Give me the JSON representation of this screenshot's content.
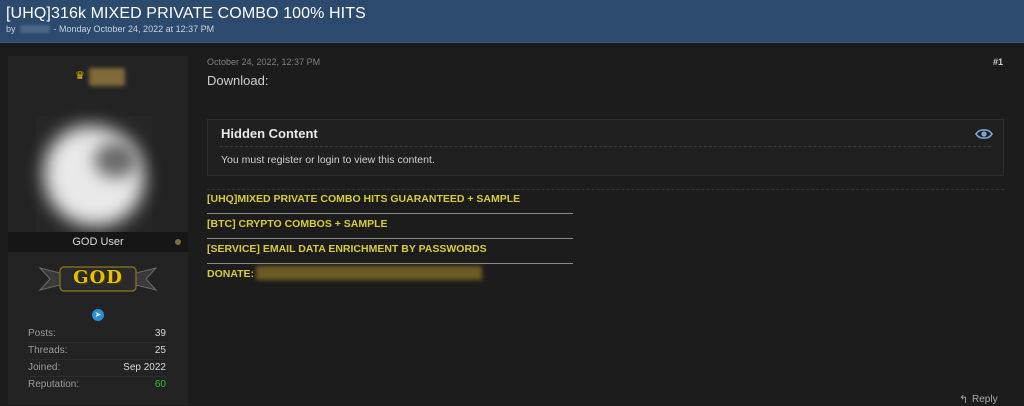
{
  "thread": {
    "title": "[UHQ]316k MIXED PRIVATE COMBO 100% HITS",
    "by_label": "by",
    "date_meta": "- Monday October 24, 2022 at 12:37 PM"
  },
  "user": {
    "rank_title": "GOD User",
    "badge_text": "GOD",
    "stats": [
      {
        "label": "Posts:",
        "value": "39"
      },
      {
        "label": "Threads:",
        "value": "25"
      },
      {
        "label": "Joined:",
        "value": "Sep 2022"
      },
      {
        "label": "Reputation:",
        "value": "60"
      }
    ]
  },
  "post": {
    "date": "October 24, 2022, 12:37 PM",
    "number": "#1",
    "download_label": "Download:",
    "hidden_title": "Hidden Content",
    "hidden_message": "You must register or login to view this content.",
    "links": [
      "[UHQ]MIXED PRIVATE COMBO HITS GUARANTEED + SAMPLE",
      "[BTC] CRYPTO COMBOS + SAMPLE",
      "[SERVICE] EMAIL DATA ENRICHMENT BY PASSWORDS",
      "DONATE:"
    ],
    "reply_label": "Reply"
  },
  "icons": {
    "crown": "crown-icon",
    "eye": "eye-icon",
    "telegram": "telegram-icon",
    "reply": "reply-icon"
  },
  "colors": {
    "header_bg": "#2b4a6d",
    "link_yellow": "#d8cc38",
    "reputation_green": "#29c329"
  }
}
